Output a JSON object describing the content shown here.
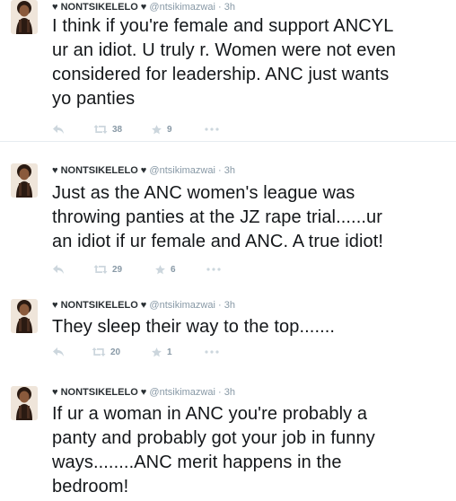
{
  "tweets": [
    {
      "display_name": "♥ NONTSIKELELO ♥",
      "username": "@ntsikimazwai",
      "separator": "·",
      "time": "3h",
      "lines": [
        "I think if you're female and support ANCYL",
        "ur an idiot. U truly r. Women were not even",
        "considered for leadership. ANC just wants",
        "yo panties"
      ],
      "retweets": "38",
      "favorites": "9"
    },
    {
      "display_name": "♥ NONTSIKELELO ♥",
      "username": "@ntsikimazwai",
      "separator": "·",
      "time": "3h",
      "lines": [
        "Just as the ANC women's league was",
        "throwing panties at the JZ rape trial......ur",
        "an idiot if ur female and ANC. A true idiot!"
      ],
      "retweets": "29",
      "favorites": "6"
    },
    {
      "display_name": "♥ NONTSIKELELO ♥",
      "username": "@ntsikimazwai",
      "separator": "·",
      "time": "3h",
      "lines": [
        "They sleep their way to the top......."
      ],
      "retweets": "20",
      "favorites": "1"
    },
    {
      "display_name": "♥ NONTSIKELELO ♥",
      "username": "@ntsikimazwai",
      "separator": "·",
      "time": "3h",
      "lines": [
        "If ur a woman in ANC you're probably a",
        "panty and probably got your job in funny",
        "ways........ANC merit happens in the",
        "bedroom!"
      ]
    }
  ],
  "icons": {
    "reply": "reply-icon",
    "retweet": "retweet-icon",
    "favorite": "star-icon",
    "more": "more-icon",
    "avatar": "avatar"
  },
  "colors": {
    "text": "#14171a",
    "meta": "#8899a6",
    "icon": "#ccd6dd",
    "divider": "#e6ecf0"
  }
}
